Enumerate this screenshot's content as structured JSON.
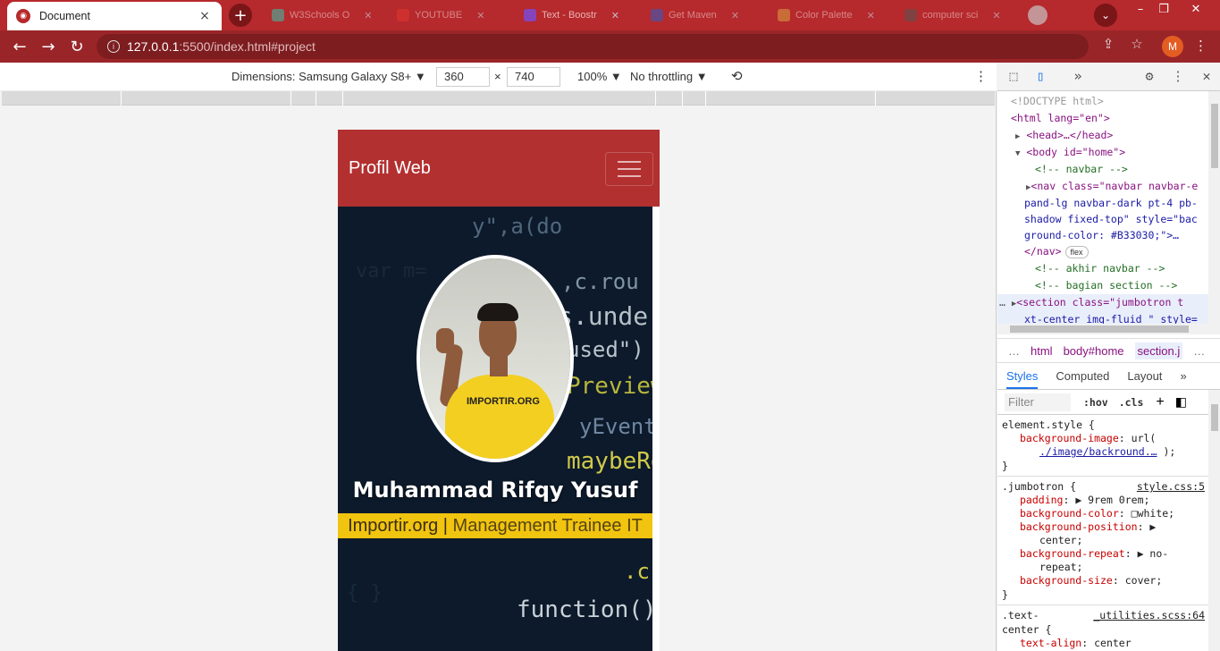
{
  "browser": {
    "active_tab": {
      "title": "Document",
      "close": "×",
      "favicon": "◉"
    },
    "new_tab": "+",
    "background_tabs": [
      {
        "title": "W3Schools O",
        "color": "#38c5b0"
      },
      {
        "title": "YOUTUBE",
        "color": "#e2362f"
      },
      {
        "title": "Text - Boostr",
        "color": "#7b4be0"
      },
      {
        "title": "Get Maven",
        "color": "#2d5fc9"
      },
      {
        "title": "Color Palette",
        "color": "#d9a441"
      },
      {
        "title": "computer sci",
        "color": "#555555"
      }
    ],
    "tab_menu": "⌄",
    "window_controls": [
      "–",
      "❐",
      "✕"
    ],
    "address_host": "127.0.0.1",
    "address_path": ":5500/index.html#project",
    "profile_initial": "M"
  },
  "device_toolbar": {
    "dimensions_label": "Dimensions: Samsung Galaxy S8+ ▼",
    "width": "360",
    "times": "×",
    "height": "740",
    "zoom": "100% ▼",
    "throttling": "No throttling ▼"
  },
  "site": {
    "brand": "Profil Web",
    "name": "Muhammad Rifqy Yusuf",
    "tagline_company": "Importir.org | ",
    "tagline_role": "Management Trainee IT",
    "shirt_text": "IMPORTIR.ORG",
    "code_lines": [
      "y\",a(do",
      ",c.rou",
      "s.unde",
      "used\")",
      "Preview",
      "yEvent",
      "maybeRe",
      ".c,ar",
      "function(){"
    ]
  },
  "devtools": {
    "elements": [
      {
        "indent": 0,
        "tri": "",
        "html": "<!DOCTYPE html>",
        "kind": "doc"
      },
      {
        "indent": 0,
        "tri": "",
        "html": "<html lang=\"en\">",
        "kind": "tag"
      },
      {
        "indent": 1,
        "tri": "▶",
        "html": "<head>…</head>",
        "kind": "tag"
      },
      {
        "indent": 1,
        "tri": "▼",
        "html": "<body id=\"home\">",
        "kind": "tag"
      },
      {
        "indent": 2,
        "tri": "",
        "html": "<!-- navbar -->",
        "kind": "comm"
      },
      {
        "indent": 2,
        "tri": "▶",
        "html": "<nav class=\"navbar navbar-e",
        "kind": "tag"
      },
      {
        "indent": 3,
        "tri": "",
        "html": "pand-lg navbar-dark pt-4 pb-",
        "kind": "val"
      },
      {
        "indent": 3,
        "tri": "",
        "html": "shadow fixed-top\" style=\"bac",
        "kind": "val"
      },
      {
        "indent": 3,
        "tri": "",
        "html": "ground-color: #B33030;\">…",
        "kind": "val"
      },
      {
        "indent": 3,
        "tri": "",
        "html": "</nav>",
        "kind": "tag",
        "badge": "flex"
      },
      {
        "indent": 2,
        "tri": "",
        "html": "<!-- akhir navbar -->",
        "kind": "comm"
      },
      {
        "indent": 2,
        "tri": "",
        "html": "<!-- bagian section -->",
        "kind": "comm"
      },
      {
        "indent": 2,
        "tri": "▶",
        "html": "<section class=\"jumbotron t",
        "kind": "tag",
        "selected": true
      },
      {
        "indent": 3,
        "tri": "",
        "html": "xt-center img-fluid \" style=",
        "kind": "val",
        "selected": true
      }
    ],
    "breadcrumbs": [
      "…",
      "html",
      "body#home",
      "section.j",
      "…"
    ],
    "sub_tabs": [
      "Styles",
      "Computed",
      "Layout",
      "»"
    ],
    "filter_placeholder": "Filter",
    "hov": ":hov",
    "cls": ".cls",
    "styles": {
      "element_selector": "element.style {",
      "bg_image_prop": "background-image",
      "bg_image_val": "url(",
      "bg_image_link": "./image/backround.…",
      "bg_image_end": ");",
      "close": "}",
      "jumbo_selector": ".jumbotron {",
      "jumbo_src": "style.css:5",
      "decls": [
        {
          "prop": "padding",
          "val": "▶ 9rem 0rem;"
        },
        {
          "prop": "background-color",
          "val": "□white;"
        },
        {
          "prop": "background-position",
          "val": "▶"
        },
        {
          "prop": "",
          "val": "center;"
        },
        {
          "prop": "background-repeat",
          "val": "▶ no-"
        },
        {
          "prop": "",
          "val": "repeat;"
        },
        {
          "prop": "background-size",
          "val": "cover;"
        }
      ],
      "text_center_selector": ".text-",
      "text_center_selector2": "center {",
      "text_center_src": "_utilities.scss:64",
      "text_align_prop": "text-align",
      "text_align_val": "center"
    }
  }
}
